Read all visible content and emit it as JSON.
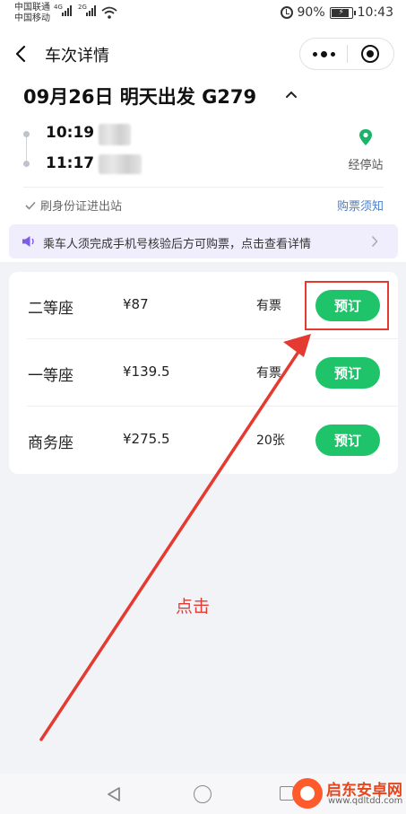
{
  "status_bar": {
    "carrier_1": "中国联通",
    "carrier_2": "中国移动",
    "net_1": "4G",
    "net_2": "2G",
    "battery": "90%",
    "time": "10:43"
  },
  "nav": {
    "title": "车次详情"
  },
  "trip": {
    "title": "09月26日 明天出发 G279",
    "depart_time": "10:19",
    "arrive_time": "11:17",
    "stops_label": "经停站"
  },
  "info": {
    "id_check": "刷身份证进出站",
    "notice_link": "购票须知"
  },
  "banner": {
    "text": "乘车人须完成手机号核验后方可购票，点击查看详情"
  },
  "seats": [
    {
      "name": "二等座",
      "price": "¥87",
      "availability": "有票",
      "button": "预订"
    },
    {
      "name": "一等座",
      "price": "¥139.5",
      "availability": "有票",
      "button": "预订"
    },
    {
      "name": "商务座",
      "price": "¥275.5",
      "availability": "20张",
      "button": "预订"
    }
  ],
  "annotation": {
    "text": "点击"
  },
  "watermark": {
    "name": "启东安卓网",
    "url": "www.qdltdd.com"
  },
  "colors": {
    "accent_green": "#1fc46a",
    "annotation_red": "#e53a32",
    "banner_bg": "#f0eefc",
    "link_blue": "#4a7fc8",
    "pin_green": "#18b468"
  }
}
